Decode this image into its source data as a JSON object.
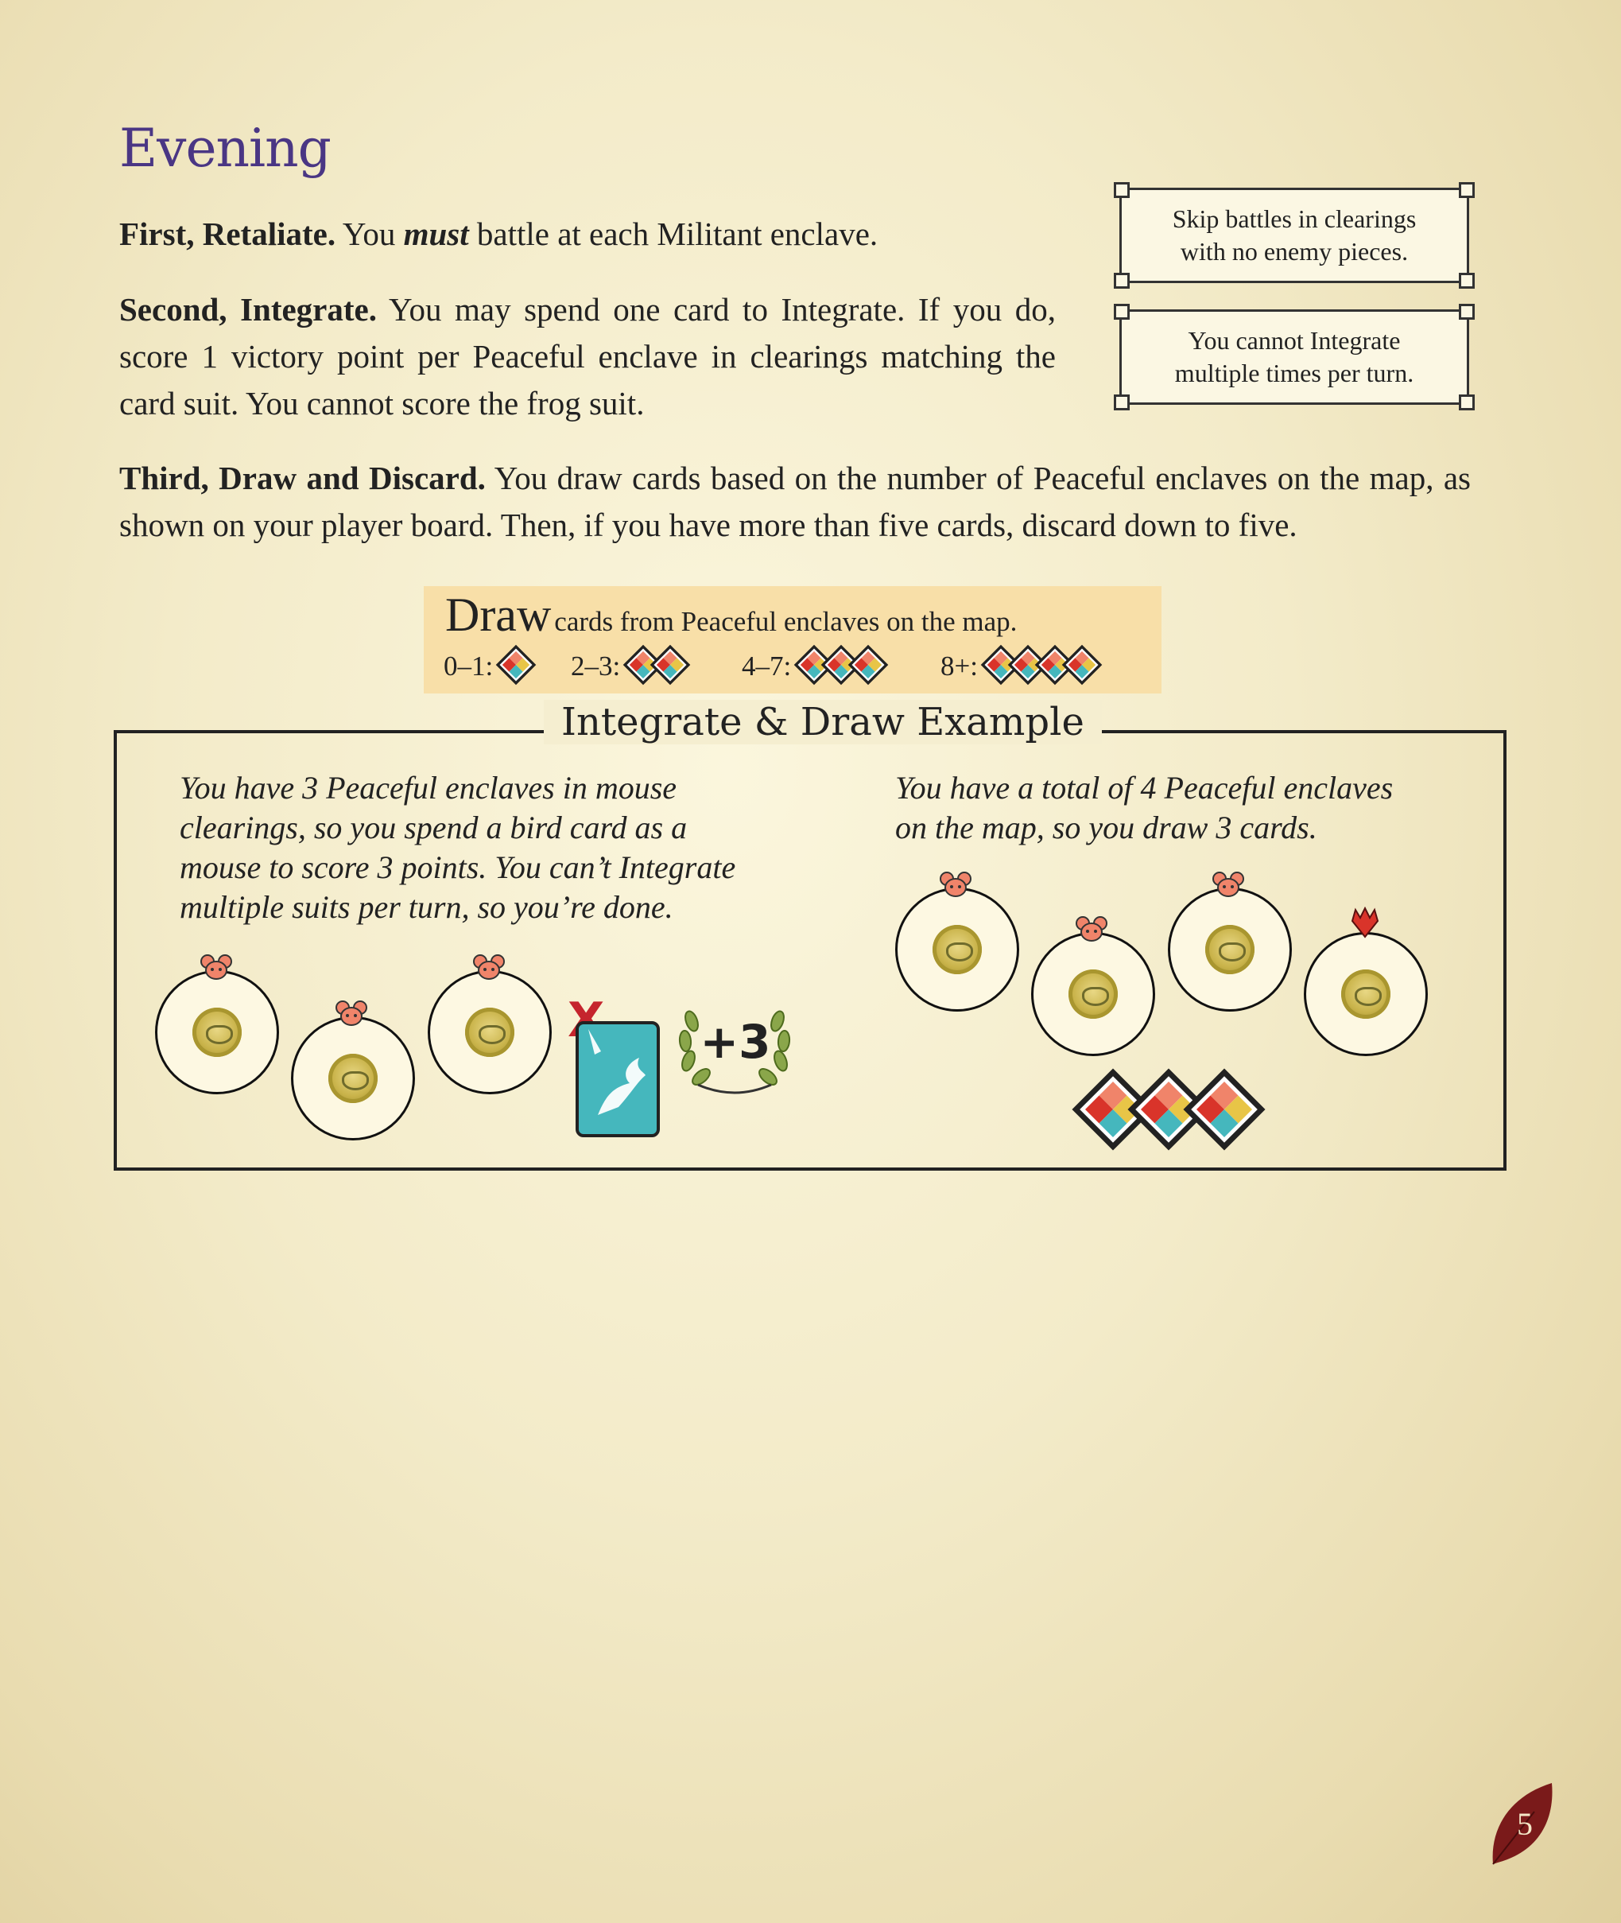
{
  "heading": "Evening",
  "step1": {
    "bold": "First, Retaliate.",
    "t1": " You ",
    "em": "must",
    "t2": " battle at each Militant enclave."
  },
  "step2": {
    "bold": "Second, Integrate.",
    "text": " You may spend one card to Integrate. If you do, score 1 victory point per Peaceful enclave in clearings matching the card suit. You cannot score the frog suit."
  },
  "step3": {
    "bold": "Third, Draw and Discard.",
    "text": " You draw cards based on the number of Peaceful enclaves on the map, as shown on your player board. Then, if you have more than five cards, discard down to five."
  },
  "notes": {
    "note1_line1": "Skip battles in clearings",
    "note1_line2": "with no enemy pieces.",
    "note2_line1": "You cannot Integrate",
    "note2_line2": "multiple times per turn."
  },
  "draw_table": {
    "big": "Draw",
    "rest": "cards from Peaceful enclaves on the map.",
    "tiers": [
      {
        "label": "0–1:",
        "cards": 1
      },
      {
        "label": "2–3:",
        "cards": 2
      },
      {
        "label": "4–7:",
        "cards": 3
      },
      {
        "label": "8+:",
        "cards": 4
      }
    ]
  },
  "example": {
    "title": "Integrate & Draw Example",
    "left_lines": [
      "You have 3 Peaceful enclaves in mouse",
      "clearings, so you spend a bird card as a",
      "mouse to score 3 points. You can’t Integrate",
      "multiple suits per turn, so you’re done."
    ],
    "right_lines": [
      "You have a total of 4 Peaceful enclaves",
      "on the map, so you draw 3 cards."
    ],
    "cross_mark": "X",
    "score": "+3",
    "drawn_cards": 3
  },
  "page_number": "5",
  "colors": {
    "heading": "#4a3684",
    "mouse": "#f0846a",
    "fox": "#d9342a",
    "bird_card": "#45b7bd",
    "laurel": "#6b8b2e",
    "draw_bg": "#f8dfa8"
  }
}
